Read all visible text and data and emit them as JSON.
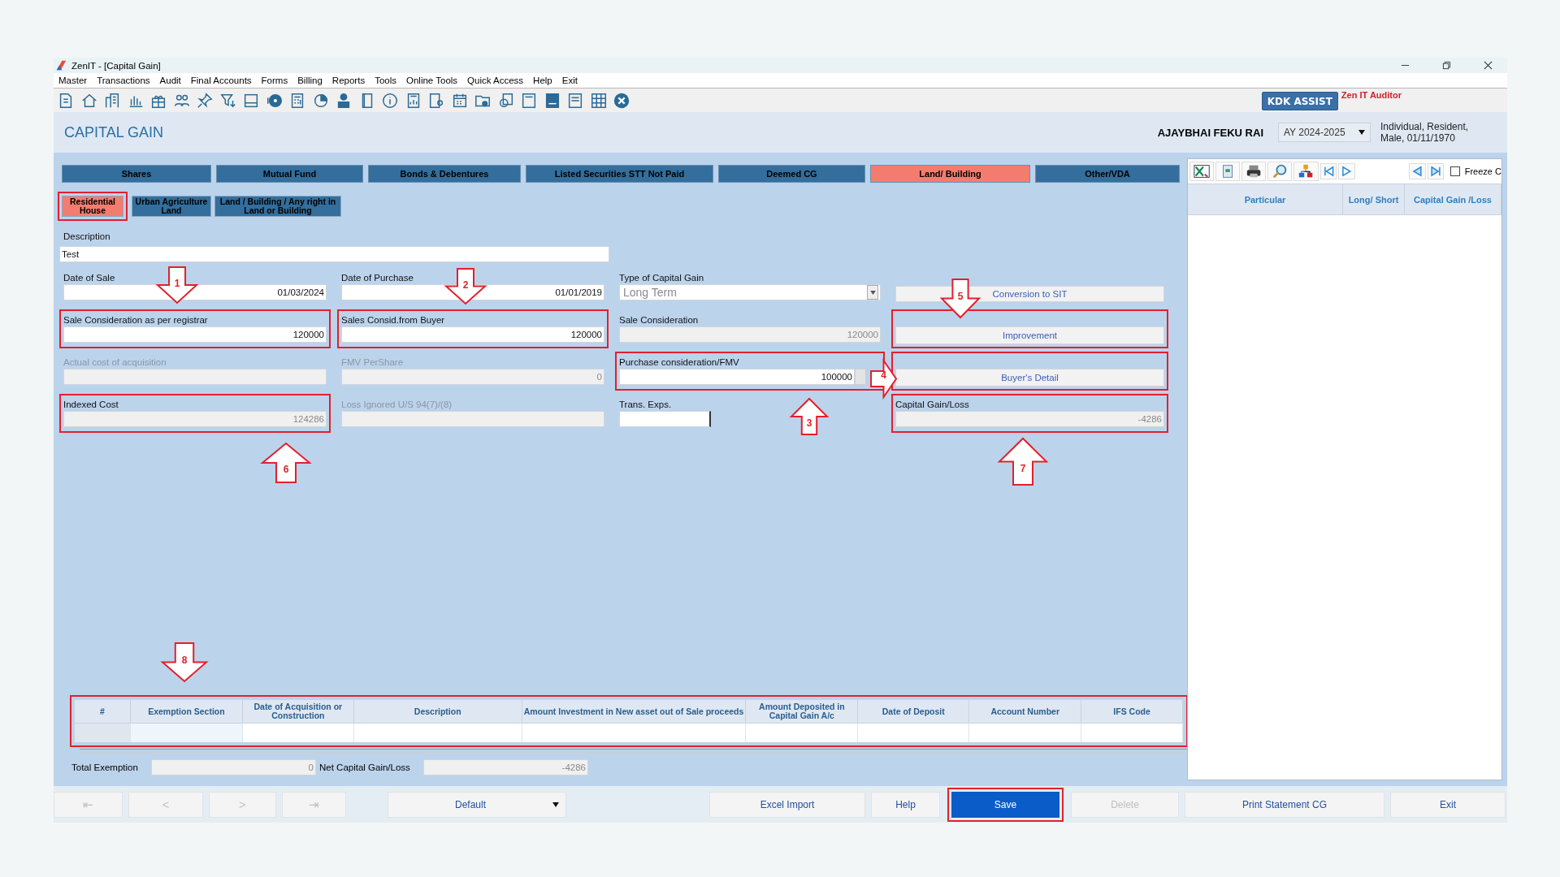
{
  "window": {
    "title": "ZenIT - [Capital Gain]"
  },
  "menu": [
    "Master",
    "Transactions",
    "Audit",
    "Final Accounts",
    "Forms",
    "Billing",
    "Reports",
    "Tools",
    "Online Tools",
    "Quick Access",
    "Help",
    "Exit"
  ],
  "assist_button": "KDK ASSIST",
  "product_label": "Zen IT Auditor",
  "page_title": "CAPITAL GAIN",
  "assessee": {
    "name": "AJAYBHAI FEKU RAI",
    "year": "AY 2024-2025",
    "details": [
      "Individual, Resident,",
      "Male, 01/11/1970"
    ]
  },
  "asset_tabs": [
    {
      "label": "Shares",
      "selected": false
    },
    {
      "label": "Mutual Fund",
      "selected": false
    },
    {
      "label": "Bonds & Debentures",
      "selected": false
    },
    {
      "label": "Listed Securities STT Not Paid",
      "selected": false
    },
    {
      "label": "Deemed CG",
      "selected": false
    },
    {
      "label": "Land/ Building",
      "selected": true
    },
    {
      "label": "Other/VDA",
      "selected": false
    }
  ],
  "property_tabs": [
    {
      "label": "Residential House",
      "selected": true,
      "highlighted": true
    },
    {
      "label": "Urban Agriculture Land",
      "selected": false,
      "highlighted": false
    },
    {
      "label": "Land / Building / Any right in Land or Building",
      "selected": false,
      "highlighted": false
    }
  ],
  "description": {
    "label": "Description",
    "value": "Test"
  },
  "form": [
    [
      {
        "kind": "field",
        "label": "Date of Sale",
        "value": "01/03/2024",
        "disabled": false,
        "read_only": false,
        "highlighted": false
      },
      {
        "kind": "field",
        "label": "Sale Consideration as per registrar",
        "value": "120000",
        "disabled": false,
        "read_only": false,
        "highlighted": true
      },
      {
        "kind": "field",
        "label": "Actual cost of acquisition",
        "disabled": true,
        "read_only": true,
        "highlighted": false
      },
      {
        "kind": "field",
        "label": "Indexed Cost",
        "value": "124286",
        "disabled": false,
        "read_only": true,
        "highlighted": true
      }
    ],
    [
      {
        "kind": "field",
        "label": "Date of Purchase",
        "value": "01/01/2019",
        "disabled": false,
        "read_only": false,
        "highlighted": false
      },
      {
        "kind": "field",
        "label": "Sales Consid.from Buyer",
        "value": "120000",
        "disabled": false,
        "read_only": false,
        "highlighted": true
      },
      {
        "kind": "field",
        "label": "FMV PerShare",
        "value": "0",
        "disabled": true,
        "read_only": true,
        "highlighted": false
      },
      {
        "kind": "field",
        "label": "Loss Ignored U/S 94(7)/(8)",
        "disabled": true,
        "read_only": true,
        "highlighted": false
      }
    ],
    [
      {
        "kind": "select",
        "label": "Type of Capital Gain",
        "value": "Long Term",
        "disabled": false,
        "read_only": false,
        "highlighted": false
      },
      {
        "kind": "field",
        "label": "Sale Consideration",
        "value": "120000",
        "disabled": false,
        "read_only": true,
        "highlighted": false
      },
      {
        "kind": "field-with-button",
        "label": "Purchase consideration/FMV",
        "value": "100000",
        "disabled": false,
        "read_only": false,
        "highlighted": true
      },
      {
        "kind": "short-field",
        "label": "Trans. Exps.",
        "disabled": false,
        "read_only": false,
        "highlighted": false
      }
    ],
    [
      {
        "kind": "button",
        "label": "Conversion to SIT",
        "highlighted": false
      },
      {
        "kind": "button",
        "label": "Improvement",
        "highlighted": true
      },
      {
        "kind": "button",
        "label": "Buyer's Detail",
        "highlighted": true
      },
      {
        "kind": "field",
        "label": "Capital Gain/Loss",
        "value": "-4286",
        "disabled": false,
        "read_only": true,
        "highlighted": true
      }
    ]
  ],
  "callouts": [
    {
      "number": "1"
    },
    {
      "number": "2"
    },
    {
      "number": "3"
    },
    {
      "number": "4"
    },
    {
      "number": "5"
    },
    {
      "number": "6"
    },
    {
      "number": "7"
    },
    {
      "number": "8"
    }
  ],
  "exemption_table": {
    "highlighted": true,
    "columns": [
      "#",
      "Exemption Section",
      "Date of Acquisition or Construction",
      "Description",
      "Amount Investment in New asset out of Sale proceeds",
      "Amount Deposited in Capital Gain A/c",
      "Date of Deposit",
      "Account Number",
      "IFS Code"
    ]
  },
  "totals": [
    {
      "label": "Total Exemption",
      "value": "0"
    },
    {
      "label": "Net Capital Gain/Loss",
      "value": "-4286"
    }
  ],
  "summary_panel": {
    "freeze": {
      "label": "Freeze C",
      "checked": false
    },
    "columns": [
      "Particular",
      "Long/ Short",
      "Capital Gain /Loss"
    ]
  },
  "nav_buttons": [
    {
      "label": "⇤",
      "disabled": true
    },
    {
      "label": "<",
      "disabled": true
    },
    {
      "label": ">",
      "disabled": true
    },
    {
      "label": "⇥",
      "disabled": true
    }
  ],
  "view_select": "Default",
  "actions": [
    {
      "label": "Excel Import",
      "primary": false,
      "disabled": false,
      "highlighted": false
    },
    {
      "label": "Help",
      "primary": false,
      "disabled": false,
      "highlighted": false
    },
    {
      "label": "Save",
      "primary": true,
      "disabled": false,
      "highlighted": true
    },
    {
      "label": "Delete",
      "primary": false,
      "disabled": true,
      "highlighted": false
    },
    {
      "label": "Print Statement CG",
      "primary": false,
      "disabled": false,
      "highlighted": false
    },
    {
      "label": "Exit",
      "primary": false,
      "disabled": false,
      "highlighted": false
    }
  ]
}
